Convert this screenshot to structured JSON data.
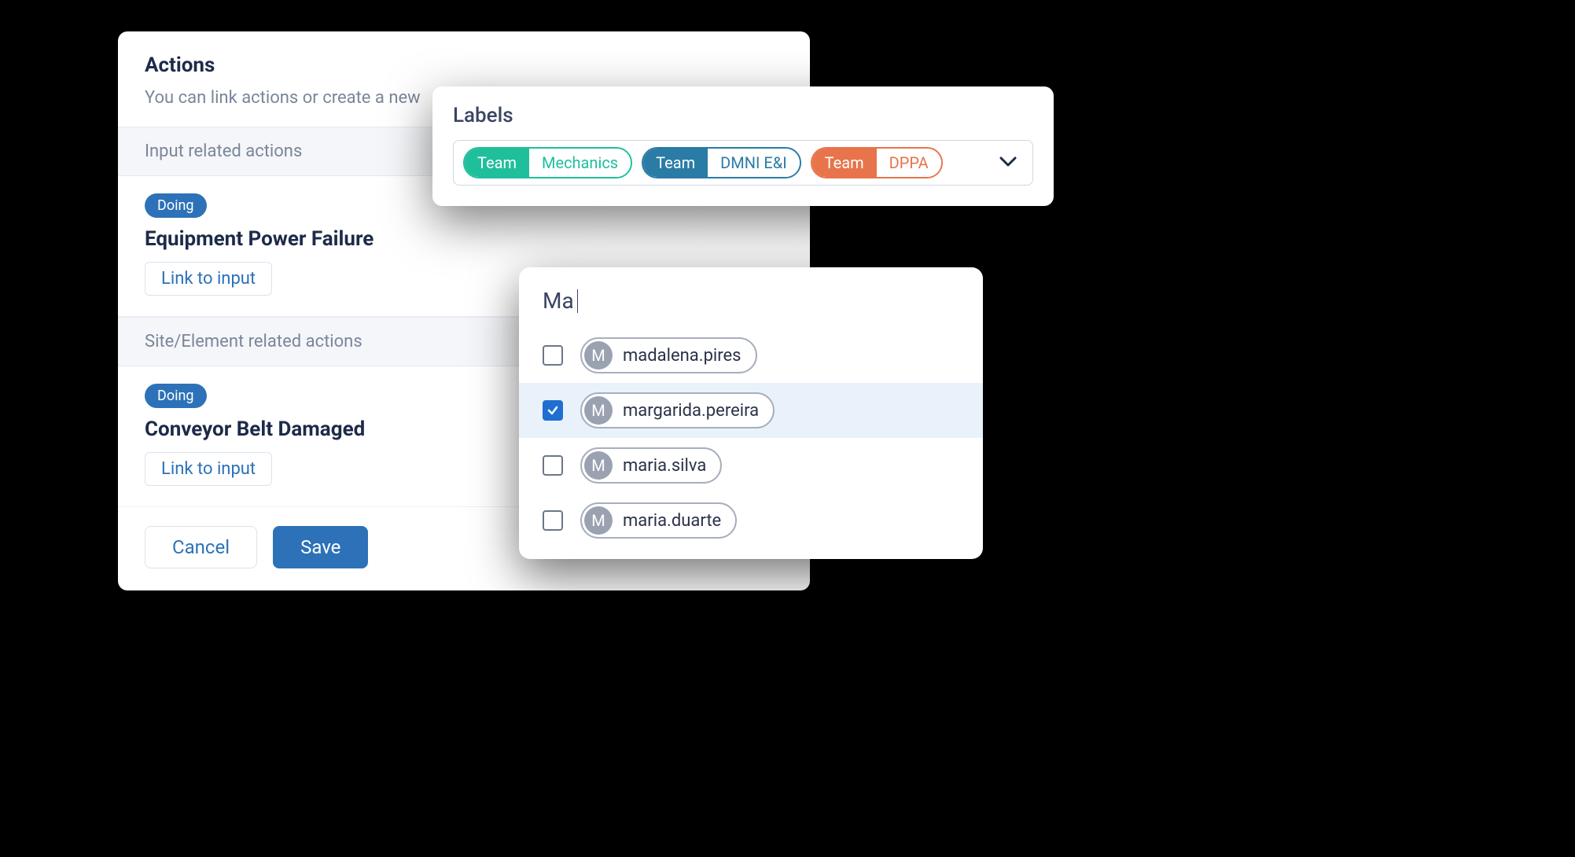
{
  "actions": {
    "title": "Actions",
    "subtitle": "You can link actions or create a new",
    "sections": [
      {
        "label": "Input related actions"
      },
      {
        "label": "Site/Element related actions"
      }
    ],
    "items": [
      {
        "status": "Doing",
        "name": "Equipment Power Failure",
        "linkLabel": "Link to input"
      },
      {
        "status": "Doing",
        "name": "Conveyor Belt Damaged",
        "linkLabel": "Link to input"
      }
    ],
    "buttons": {
      "cancel": "Cancel",
      "save": "Save"
    }
  },
  "labels": {
    "title": "Labels",
    "tags": [
      {
        "left": "Team",
        "right": "Mechanics",
        "color": "green"
      },
      {
        "left": "Team",
        "right": "DMNI E&I",
        "color": "blue"
      },
      {
        "left": "Team",
        "right": "DPPA",
        "color": "orange"
      }
    ]
  },
  "picker": {
    "query": "Ma",
    "avatarLetter": "M",
    "users": [
      {
        "name": "madalena.pires",
        "checked": false
      },
      {
        "name": "margarida.pereira",
        "checked": true
      },
      {
        "name": "maria.silva",
        "checked": false
      },
      {
        "name": "maria.duarte",
        "checked": false
      }
    ]
  }
}
